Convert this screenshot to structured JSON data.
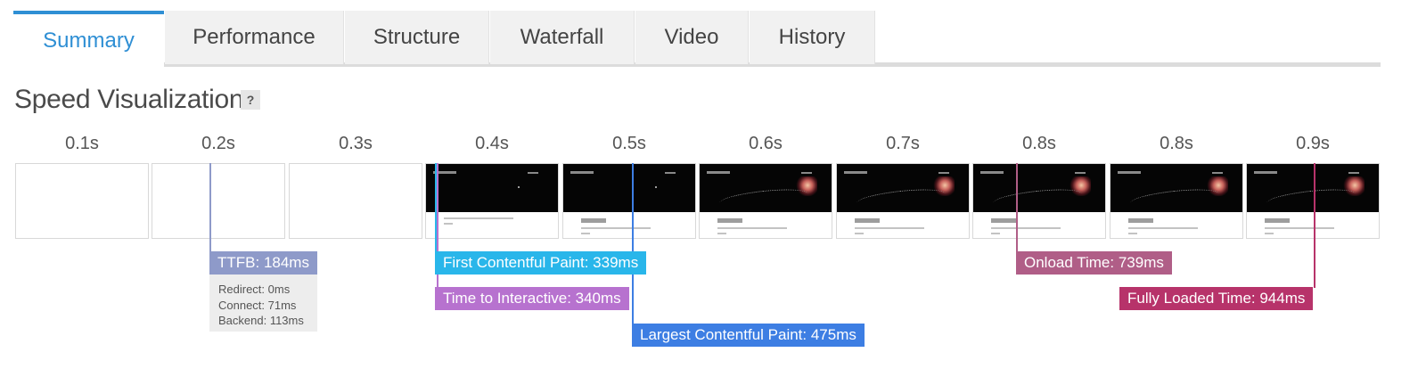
{
  "tabs": [
    {
      "label": "Summary",
      "active": true
    },
    {
      "label": "Performance",
      "active": false
    },
    {
      "label": "Structure",
      "active": false
    },
    {
      "label": "Waterfall",
      "active": false
    },
    {
      "label": "Video",
      "active": false
    },
    {
      "label": "History",
      "active": false
    }
  ],
  "heading": "Speed Visualization",
  "help_label": "?",
  "timeline_labels": [
    "0.1s",
    "0.2s",
    "0.3s",
    "0.4s",
    "0.5s",
    "0.6s",
    "0.7s",
    "0.8s",
    "0.8s",
    "0.9s"
  ],
  "markers": {
    "ttfb": "TTFB: 184ms",
    "fcp": "First Contentful Paint: 339ms",
    "tti": "Time to Interactive: 340ms",
    "lcp": "Largest Contentful Paint: 475ms",
    "onload": "Onload Time: 739ms",
    "fully_loaded": "Fully Loaded Time: 944ms"
  },
  "ttfb_breakdown": {
    "redirect": "Redirect: 0ms",
    "connect": "Connect: 71ms",
    "backend": "Backend: 113ms"
  },
  "colors": {
    "accent": "#2f8fd4",
    "ttfb": "#8e9ac9",
    "fcp": "#29b6ea",
    "tti": "#b772cf",
    "lcp": "#3d7ee3",
    "onload": "#b05e87",
    "fully_loaded": "#b7336a"
  }
}
